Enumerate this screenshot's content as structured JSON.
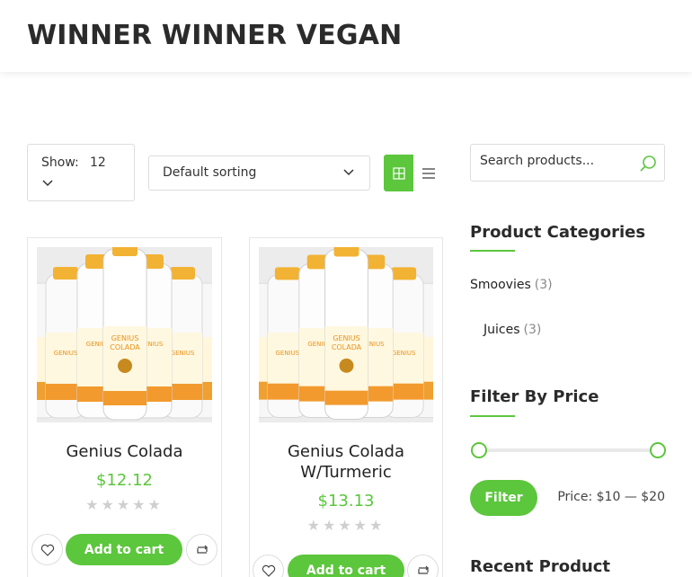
{
  "header": {
    "logo": "WINNER WINNER VEGAN"
  },
  "toolbar": {
    "show_label": "Show:",
    "show_value": "12",
    "sorting_label": "Default sorting"
  },
  "products": [
    {
      "title_line1": "Genius Colada",
      "title_line2": "",
      "price": "$12.12",
      "add_to_cart": "Add to cart",
      "rating_stars": 0
    },
    {
      "title_line1": "Genius Colada",
      "title_line2": "W/Turmeric",
      "price": "$13.13",
      "add_to_cart": "Add to cart",
      "rating_stars": 0
    }
  ],
  "sidebar": {
    "search_placeholder": "Search products...",
    "categories_title": "Product Categories",
    "categories": [
      {
        "name": "Smoovies",
        "count": "(3)"
      },
      {
        "name": "Juices",
        "count": "(3)"
      }
    ],
    "filter_title": "Filter By Price",
    "filter_button": "Filter",
    "price_label": "Price: $10 — $20",
    "recent_title": "Recent Product"
  },
  "colors": {
    "accent": "#5cc63d"
  }
}
